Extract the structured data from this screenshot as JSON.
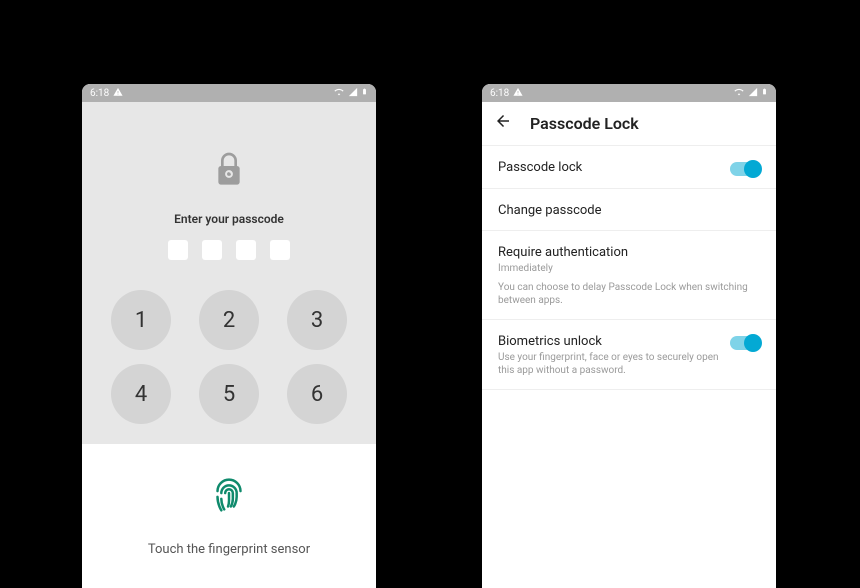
{
  "status": {
    "time": "6:18",
    "warning_icon": "warning-icon"
  },
  "passcode": {
    "prompt": "Enter your passcode",
    "keys": [
      "1",
      "2",
      "3",
      "4",
      "5",
      "6"
    ],
    "fingerprint_prompt": "Touch the fingerprint sensor"
  },
  "settings": {
    "title": "Passcode Lock",
    "rows": {
      "lock": {
        "title": "Passcode lock",
        "on": true
      },
      "change": {
        "title": "Change passcode"
      },
      "require": {
        "title": "Require authentication",
        "sub": "Immediately",
        "desc": "You can choose to delay Passcode Lock when switching between apps."
      },
      "biometrics": {
        "title": "Biometrics unlock",
        "desc": "Use your fingerprint, face or eyes to securely open this app without a password.",
        "on": true
      }
    }
  }
}
